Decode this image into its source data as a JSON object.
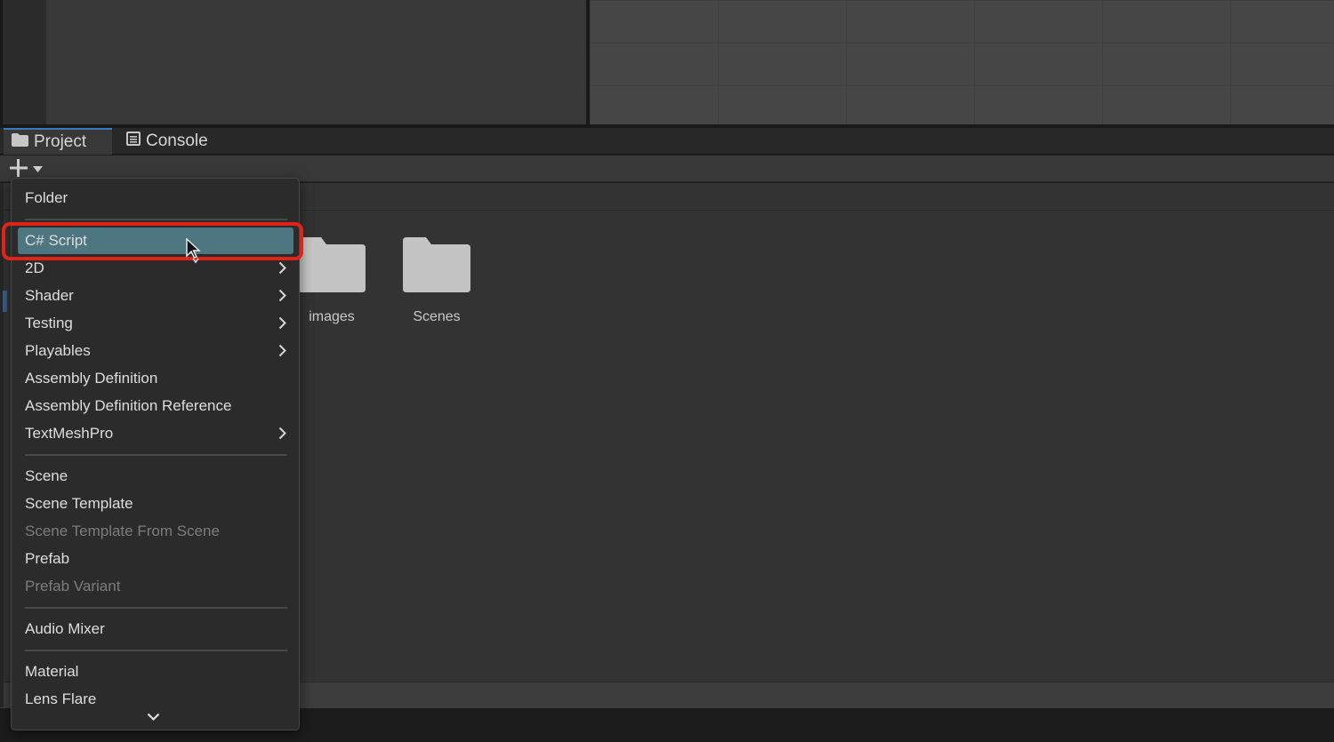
{
  "tabs": [
    {
      "label": "Project",
      "icon": "folder-icon",
      "active": true
    },
    {
      "label": "Console",
      "icon": "console-list-icon",
      "active": false
    }
  ],
  "toolbar": {
    "add_icon": "plus-icon",
    "dropdown_icon": "caret-down-icon"
  },
  "folders": [
    {
      "label": "images",
      "icon": "folder-icon"
    },
    {
      "label": "Scenes",
      "icon": "folder-icon"
    }
  ],
  "menu": {
    "items": [
      {
        "label": "Folder"
      },
      {
        "label": "C# Script",
        "highlighted": true
      },
      {
        "label": "2D",
        "submenu": true
      },
      {
        "label": "Shader",
        "submenu": true
      },
      {
        "label": "Testing",
        "submenu": true
      },
      {
        "label": "Playables",
        "submenu": true
      },
      {
        "label": "Assembly Definition"
      },
      {
        "label": "Assembly Definition Reference"
      },
      {
        "label": "TextMeshPro",
        "submenu": true
      },
      {
        "label": "Scene"
      },
      {
        "label": "Scene Template"
      },
      {
        "label": "Scene Template From Scene",
        "disabled": true
      },
      {
        "label": "Prefab"
      },
      {
        "label": "Prefab Variant",
        "disabled": true
      },
      {
        "label": "Audio Mixer"
      },
      {
        "label": "Material"
      },
      {
        "label": "Lens Flare"
      }
    ],
    "scroll_icon": "chevron-down-icon"
  },
  "colors": {
    "highlight": "#4d7680",
    "annotation": "#e2231a",
    "tab_accent": "#3a79bb",
    "folder": "#c4c4c4"
  }
}
